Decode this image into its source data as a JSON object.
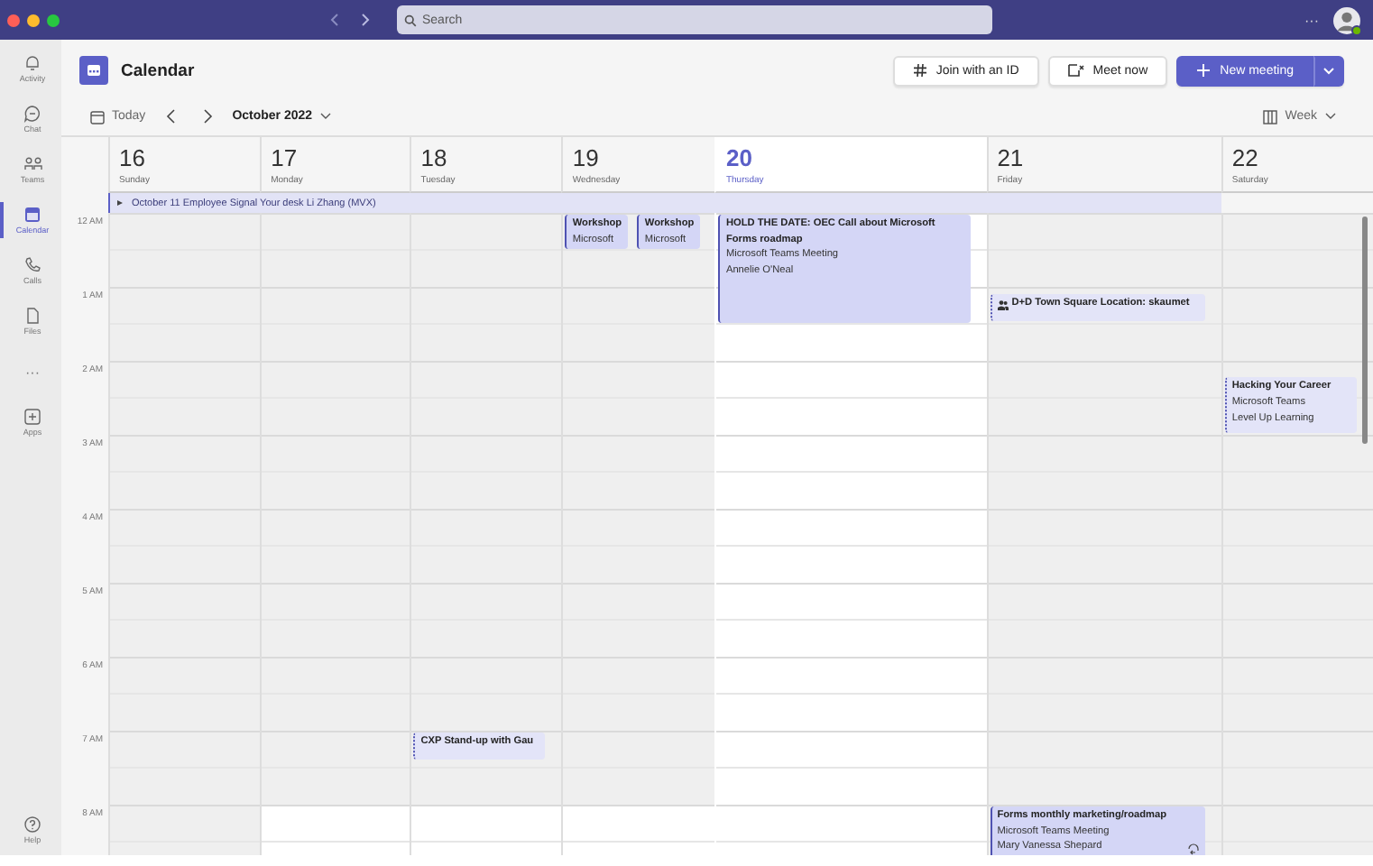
{
  "window": {
    "search": {
      "placeholder": "Search"
    },
    "more": "···"
  },
  "rail": [
    {
      "kind": "bell",
      "label": "Activity",
      "selected": false
    },
    {
      "kind": "chat",
      "label": "Chat",
      "selected": false
    },
    {
      "kind": "teams",
      "label": "Teams",
      "selected": false
    },
    {
      "kind": "calendar",
      "label": "Calendar",
      "selected": true
    },
    {
      "kind": "phone",
      "label": "Calls",
      "selected": false
    },
    {
      "kind": "file",
      "label": "Files",
      "selected": false
    },
    {
      "kind": "more",
      "label": "···",
      "selected": false
    },
    {
      "kind": "apps",
      "label": "Apps",
      "selected": false
    }
  ],
  "help": {
    "label": "Help"
  },
  "header": {
    "title": "Calendar",
    "buttons": [
      {
        "kind": "hash",
        "label": "Join with an ID"
      },
      {
        "kind": "meet",
        "label": "Meet now"
      },
      {
        "kind": "new",
        "label": "New meeting"
      }
    ]
  },
  "toolbar": {
    "today": "Today",
    "month": "October 2022",
    "view": "Week"
  },
  "all_day_event": {
    "title": "October 11  Employee Signal  Your desk  Li Zhang (MVX)"
  },
  "times": [
    "12 AM",
    "1 AM",
    "2 AM",
    "3 AM",
    "4 AM",
    "5 AM",
    "6 AM",
    "7 AM",
    "8 AM"
  ],
  "days": [
    {
      "date": "16",
      "weekday": "Sunday",
      "selected": false,
      "working_day": false
    },
    {
      "date": "17",
      "weekday": "Monday",
      "selected": false,
      "working_day": true
    },
    {
      "date": "18",
      "weekday": "Tuesday",
      "selected": false,
      "working_day": true,
      "events": [
        {
          "kind": "tentative",
          "title": "CXP Stand-up with Gau"
        }
      ]
    },
    {
      "date": "19",
      "weekday": "Wednesday",
      "selected": false,
      "working_day": true,
      "events": [
        {
          "kind": "busy",
          "title": "Workshop",
          "details": [
            "Microsoft"
          ]
        },
        {
          "kind": "busy",
          "title": "Workshop",
          "details": [
            "Microsoft"
          ]
        }
      ]
    },
    {
      "date": "20",
      "weekday": "Thursday",
      "selected": true,
      "events": [
        {
          "kind": "busy",
          "title": "HOLD THE DATE: OEC Call about Microsoft Forms roadmap",
          "details": [
            "Microsoft Teams Meeting",
            "Annelie O'Neal"
          ]
        }
      ]
    },
    {
      "date": "21",
      "weekday": "Friday",
      "selected": false,
      "working_day": false,
      "events": [
        {
          "kind": "tentative",
          "title": "D+D Town Square  Location: skaumet"
        },
        {
          "kind": "busy",
          "title": "Forms monthly marketing/roadmap",
          "details": [
            "Microsoft Teams Meeting",
            "Mary Vanessa Shepard"
          ]
        }
      ]
    },
    {
      "date": "22",
      "weekday": "Saturday",
      "selected": false,
      "working_day": false,
      "events": [
        {
          "kind": "tentative",
          "title": "Hacking Your Career",
          "details": [
            "Microsoft Teams",
            "Level Up Learning"
          ]
        }
      ]
    }
  ]
}
